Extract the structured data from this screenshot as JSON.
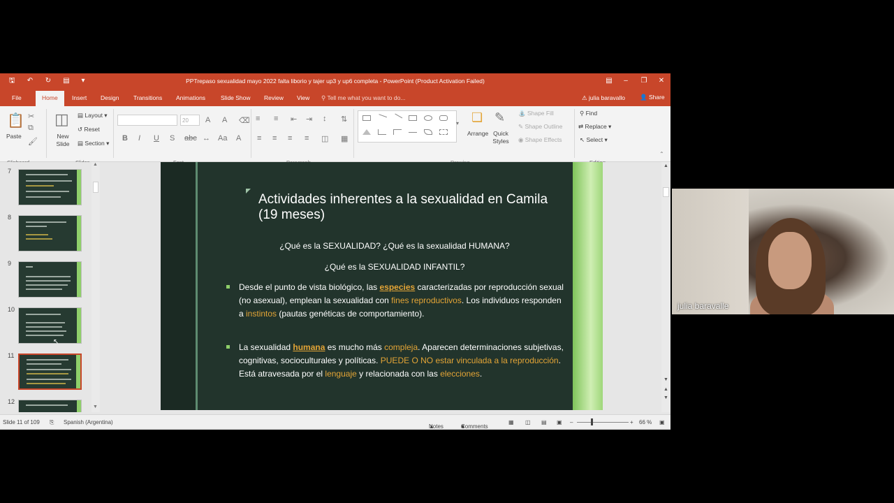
{
  "window": {
    "title": "PPTrepaso sexualidad mayo 2022 falta liborio y tajer up3 y up6 completa - PowerPoint (Product Activation Failed)"
  },
  "tabs": [
    "File",
    "Home",
    "Insert",
    "Design",
    "Transitions",
    "Animations",
    "Slide Show",
    "Review",
    "View"
  ],
  "tell_me": "Tell me what you want to do...",
  "user_name": "julia baravallo",
  "share_label": "Share",
  "ribbon": {
    "clipboard": {
      "paste": "Paste",
      "group": "Clipboard"
    },
    "slides": {
      "new_slide": "New Slide",
      "layout": "Layout",
      "reset": "Reset",
      "section": "Section",
      "group": "Slides"
    },
    "font": {
      "size": "20",
      "group": "Font"
    },
    "paragraph": {
      "group": "Paragraph"
    },
    "drawing": {
      "arrange": "Arrange",
      "quick_styles": "Quick Styles",
      "shape_fill": "Shape Fill",
      "shape_outline": "Shape Outline",
      "shape_effects": "Shape Effects",
      "group": "Drawing"
    },
    "editing": {
      "find": "Find",
      "replace": "Replace",
      "select": "Select",
      "group": "Editing"
    }
  },
  "thumbnails": [
    {
      "number": "7"
    },
    {
      "number": "8"
    },
    {
      "number": "9"
    },
    {
      "number": "10"
    },
    {
      "number": "11",
      "selected": true
    },
    {
      "number": "12"
    }
  ],
  "slide": {
    "title": "Actividades inherentes a la sexualidad en Camila (19 meses)",
    "question1": "¿Qué es la SEXUALIDAD? ¿Qué es la sexualidad HUMANA?",
    "question2": "¿Qué es la SEXUALIDAD INFANTIL?",
    "bullet1": {
      "a": "Desde el punto de vista biológico, las ",
      "b": "especies",
      "c": " caracterizadas por reproducción sexual (no asexual), emplean la sexualidad con ",
      "d": "fines reproductivos",
      "e": ". Los individuos responden a ",
      "f": "instintos",
      "g": " (pautas genéticas de comportamiento)."
    },
    "bullet2": {
      "a": "La sexualidad ",
      "b": "humana",
      "c": " es mucho más ",
      "d": "compleja",
      "e": ". Aparecen determinaciones subjetivas, cognitivas, socioculturales y políticas. ",
      "f": "PUEDE O NO estar vinculada a la reproducción",
      "g": ". Está atravesada por el ",
      "h": "lenguaje",
      "i": " y relacionada con las ",
      "j": "elecciones",
      "k": "."
    }
  },
  "status": {
    "slide_counter": "Slide 11 of 109",
    "language": "Spanish (Argentina)",
    "notes": "Notes",
    "comments": "Comments",
    "zoom": "66 %"
  },
  "webcam": {
    "name": "julia baravalle"
  },
  "colors": {
    "accent": "#c8462a",
    "slide_bg": "#22342c",
    "highlight": "#e3a436"
  }
}
